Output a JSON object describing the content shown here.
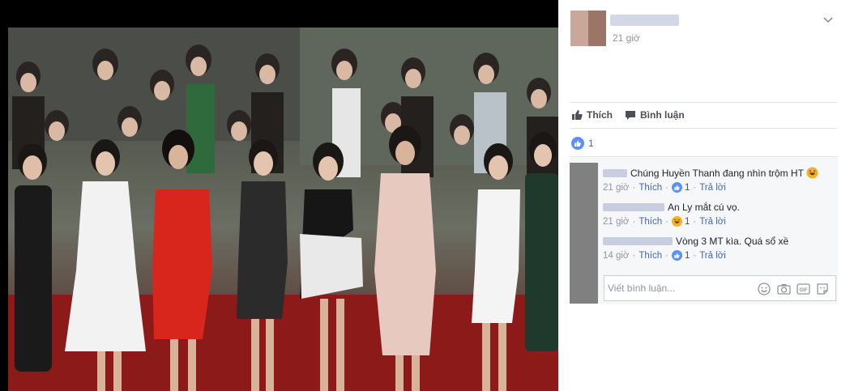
{
  "post": {
    "time": "21 giờ",
    "actions": {
      "like": "Thích",
      "comment": "Bình luận"
    },
    "reaction_count": "1"
  },
  "comments": [
    {
      "text": "Chúng Huyền Thanh đang nhìn trộm HT",
      "time": "21 giờ",
      "like": "Thích",
      "likes": "1",
      "reply": "Trả lời"
    },
    {
      "text": "An Ly mắt cú vọ.",
      "time": "21 giờ",
      "like": "Thích",
      "likes": "1",
      "reply": "Trả lời"
    },
    {
      "text": "Vòng 3 MT kìa. Quá sổ xề",
      "time": "14 giờ",
      "like": "Thích",
      "likes": "1",
      "reply": "Trả lời"
    }
  ],
  "composer": {
    "placeholder": "Viết bình luận...",
    "gif_label": "GIF"
  },
  "colors": {
    "link": "#4267b2",
    "muted": "#90949c",
    "haha": "#f7b125"
  },
  "icons": [
    "thumbs-up-icon",
    "comment-bubble-icon",
    "like-reaction-icon",
    "haha-emoji-icon",
    "smile-icon",
    "camera-icon",
    "gif-icon",
    "sticker-icon",
    "chevron-down-icon"
  ]
}
